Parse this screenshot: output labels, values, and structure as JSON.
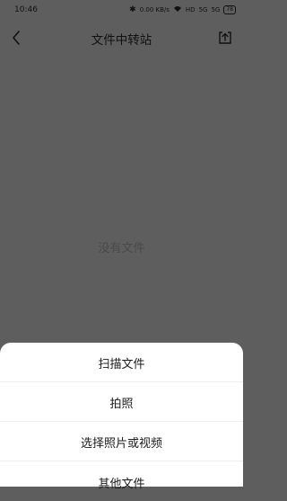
{
  "status": {
    "time": "10:46",
    "speed": "0.00 KB/s",
    "hd": "HD",
    "sim1": "5G",
    "sim2": "5G",
    "battery": "78"
  },
  "nav": {
    "title": "文件中转站"
  },
  "empty_state": {
    "text": "没有文件"
  },
  "sheet": {
    "items": [
      {
        "label": "扫描文件"
      },
      {
        "label": "拍照"
      },
      {
        "label": "选择照片或视频"
      },
      {
        "label": "其他文件"
      }
    ]
  },
  "icons": {
    "back": "chevron-left-icon",
    "upload": "upload-icon"
  },
  "colors": {
    "overlay_bg": "#5e5e5e",
    "sheet_bg": "#ffffff"
  }
}
